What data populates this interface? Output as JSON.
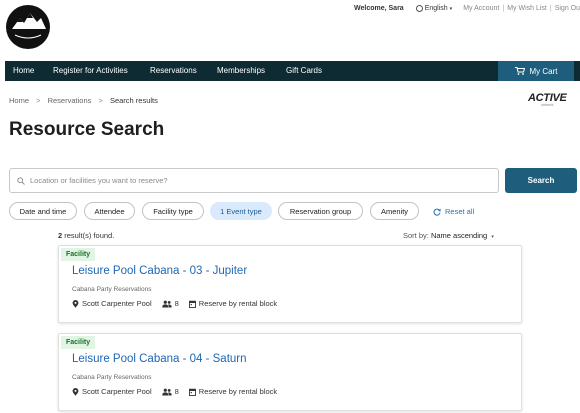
{
  "logo": {
    "text": "CITY OF BOULDER"
  },
  "utility": {
    "welcome": "Welcome, Sara",
    "language": "English",
    "links": [
      "My Account",
      "My Wish List",
      "Sign Ou"
    ]
  },
  "nav": {
    "items": [
      "Home",
      "Register for Activities",
      "Reservations",
      "Memberships",
      "Gift Cards"
    ],
    "cart_label": "My Cart"
  },
  "breadcrumb": [
    "Home",
    "Reservations",
    "Search results"
  ],
  "active_logo": {
    "text": "ACTIVE",
    "subtext": "network"
  },
  "page_title": "Resource Search",
  "search": {
    "placeholder": "Location or facilities you want to reserve?",
    "value": "",
    "button_label": "Search"
  },
  "filters": [
    {
      "label": "Date and time",
      "selected": false
    },
    {
      "label": "Attendee",
      "selected": false
    },
    {
      "label": "Facility type",
      "selected": false
    },
    {
      "label": "1 Event type",
      "selected": true
    },
    {
      "label": "Reservation group",
      "selected": false
    },
    {
      "label": "Amenity",
      "selected": false
    }
  ],
  "reset_label": "Reset all",
  "results": {
    "count": "2",
    "count_suffix": "result(s) found.",
    "sort_label": "Sort by:",
    "sort_value": "Name ascending"
  },
  "cards": [
    {
      "tag": "Facility",
      "name": "Leisure Pool Cabana - 03 - Jupiter",
      "subtitle": "Cabana Party Reservations",
      "location": "Scott Carpenter Pool",
      "capacity": "8",
      "reserve": "Reserve by rental block"
    },
    {
      "tag": "Facility",
      "name": "Leisure Pool Cabana - 04 - Saturn",
      "subtitle": "Cabana Party Reservations",
      "location": "Scott Carpenter Pool",
      "capacity": "8",
      "reserve": "Reserve by rental block"
    }
  ],
  "colors": {
    "nav_bg": "#0e2a33",
    "accent": "#1f5d7d",
    "link": "#2067b6",
    "chip_selected_bg": "#d8eafb",
    "tag_bg": "#e2f5e4",
    "tag_text": "#1a6f2a"
  }
}
